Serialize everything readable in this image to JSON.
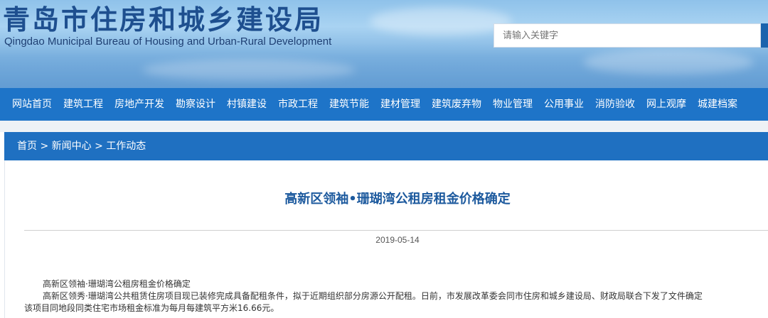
{
  "header": {
    "title_cn": "青岛市住房和城乡建设局",
    "title_en": "Qingdao Municipal Bureau of Housing and Urban-Rural Development",
    "search_placeholder": "请输入关键字"
  },
  "nav": {
    "items": [
      {
        "label": "网站首页"
      },
      {
        "label": "建筑工程"
      },
      {
        "label": "房地产开发"
      },
      {
        "label": "勘察设计"
      },
      {
        "label": "村镇建设"
      },
      {
        "label": "市政工程"
      },
      {
        "label": "建筑节能"
      },
      {
        "label": "建材管理"
      },
      {
        "label": "建筑废弃物"
      },
      {
        "label": "物业管理"
      },
      {
        "label": "公用事业"
      },
      {
        "label": "消防验收"
      },
      {
        "label": "网上观摩"
      },
      {
        "label": "城建档案"
      }
    ]
  },
  "breadcrumb": {
    "home": "首页",
    "sep": " > ",
    "section": "新闻中心",
    "current": "工作动态"
  },
  "article": {
    "title": "高新区领袖•珊瑚湾公租房租金价格确定",
    "date": "2019-05-14",
    "para1": "高新区领袖·珊瑚湾公租房租金价格确定",
    "para2a": "高新区领秀·珊瑚湾公共租赁住房项目现已装修完成具备配租条件，拟于近期组织部分房源公开配租。日前，市发展改革委会同市住房和城乡建设局、财政局联合下发了文件确定",
    "para2b": "该项目同地段同类住宅市场租金标准为每月每建筑平方米16.66元。"
  },
  "colors": {
    "nav_bg": "#1e74c8",
    "breadcrumb_bg": "#1f70c1",
    "title": "#1d5a9e"
  }
}
